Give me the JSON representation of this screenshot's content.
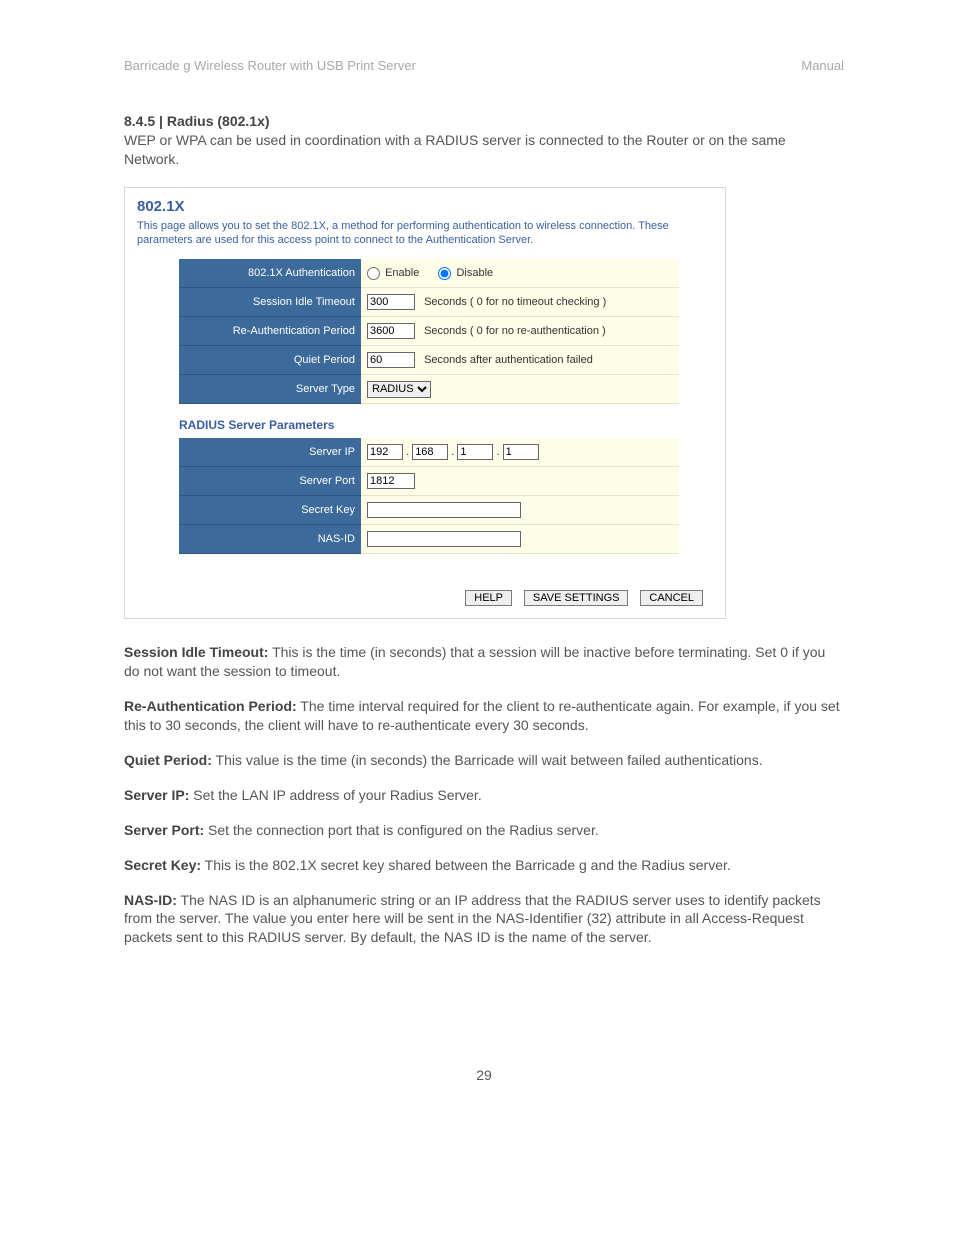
{
  "header": {
    "left": "Barricade g Wireless Router with USB Print Server",
    "right": "Manual"
  },
  "section": {
    "heading": "8.4.5 | Radius (802.1x)",
    "intro": "WEP or WPA can be used in coordination with a RADIUS server is connected to the Router or on the same Network."
  },
  "panel": {
    "title": "802.1X",
    "desc": "This page allows you to set the 802.1X, a method for performing authentication to wireless connection.  These parameters are used for this access point to connect to the Authentication Server.",
    "rows1": {
      "auth": {
        "label": "802.1X Authentication",
        "enable": "Enable",
        "disable": "Disable",
        "selected": "disable"
      },
      "idle": {
        "label": "Session Idle Timeout",
        "value": "300",
        "hint": "Seconds ( 0 for no timeout checking )"
      },
      "reauth": {
        "label": "Re-Authentication Period",
        "value": "3600",
        "hint": "Seconds ( 0 for no re-authentication )"
      },
      "quiet": {
        "label": "Quiet Period",
        "value": "60",
        "hint": "Seconds after authentication failed"
      },
      "servertype": {
        "label": "Server Type",
        "value": "RADIUS"
      }
    },
    "subhead": "RADIUS Server Parameters",
    "rows2": {
      "serverip": {
        "label": "Server IP",
        "o1": "192",
        "o2": "168",
        "o3": "1",
        "o4": "1",
        "dot": "."
      },
      "serverport": {
        "label": "Server Port",
        "value": "1812"
      },
      "secret": {
        "label": "Secret Key",
        "value": ""
      },
      "nasid": {
        "label": "NAS-ID",
        "value": ""
      }
    },
    "buttons": {
      "help": "HELP",
      "save": "SAVE SETTINGS",
      "cancel": "CANCEL"
    }
  },
  "defs": {
    "idle": {
      "term": "Session Idle Timeout:",
      "text": " This is the time (in seconds) that a session will be inactive before terminating. Set 0 if you do not want the session to timeout."
    },
    "reauth": {
      "term": "Re-Authentication Period:",
      "text": " The time interval required for the client to re-authenticate again. For example, if you set this to 30 seconds, the client will have to re-authenticate every 30 seconds."
    },
    "quiet": {
      "term": "Quiet Period:",
      "text": " This value is the time (in seconds) the Barricade will wait between failed authentications."
    },
    "sip": {
      "term": "Server IP:",
      "text": " Set the LAN IP address of your Radius Server."
    },
    "sport": {
      "term": "Server Port:",
      "text": " Set the connection port that is configured on the Radius server."
    },
    "skey": {
      "term": "Secret Key:",
      "text": " This is the 802.1X secret key shared between the Barricade g and the Radius server."
    },
    "nasid": {
      "term": "NAS-ID:",
      "text": " The NAS ID is an alphanumeric string or an IP address that the RADIUS server uses to identify packets from the server. The value you enter here will be sent in the NAS-Identifier (32) attribute in all Access-Request packets sent to this RADIUS server. By default, the NAS ID is the name of the server."
    }
  },
  "page_number": "29"
}
